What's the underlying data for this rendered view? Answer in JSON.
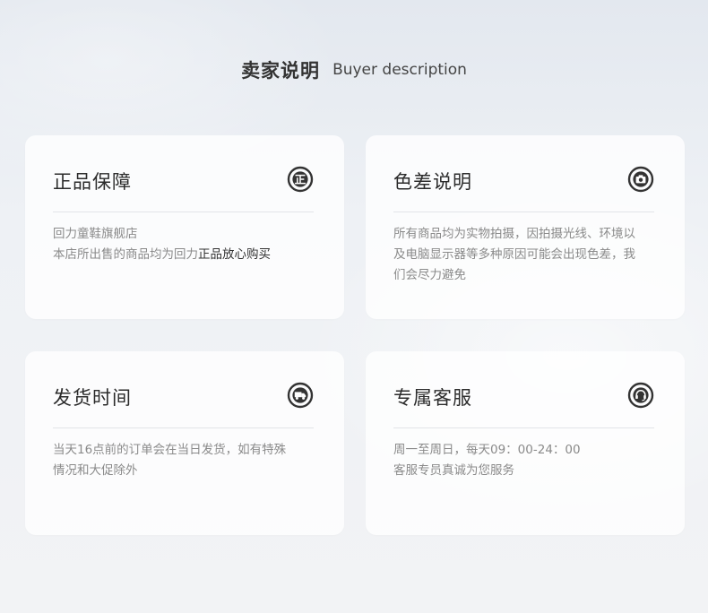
{
  "header": {
    "title_cn": "卖家说明",
    "title_en": "Buyer description"
  },
  "cards": [
    {
      "title": "正品保障",
      "icon": "genuine-badge-icon",
      "lines": [
        {
          "text": "回力童鞋旗舰店"
        },
        {
          "text": "本店所出售的商品均为回力",
          "highlight": "正品放心购买"
        }
      ]
    },
    {
      "title": "色差说明",
      "icon": "camera-icon",
      "lines": [
        {
          "text": "所有商品均为实物拍摄，因拍摄光线、环境以"
        },
        {
          "text": "及电脑显示器等多种原因可能会出现色差，我"
        },
        {
          "text": "们会尽力避免"
        }
      ]
    },
    {
      "title": "发货时间",
      "icon": "delivery-truck-icon",
      "lines": [
        {
          "text": "当天16点前的订单会在当日发货，如有特殊"
        },
        {
          "text": "情况和大促除外"
        }
      ]
    },
    {
      "title": "专属客服",
      "icon": "headset-icon",
      "lines": [
        {
          "text": "周一至周日，每天09：00-24：00"
        },
        {
          "text": "客服专员真诚为您服务"
        }
      ]
    }
  ]
}
